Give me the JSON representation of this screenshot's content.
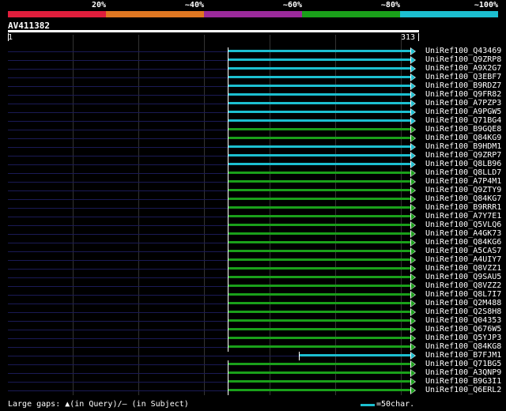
{
  "legend": {
    "colors": [
      "#e01e3c",
      "#e07722",
      "#9b2a9b",
      "#1aa01a",
      "#1cbfd0"
    ],
    "labels": [
      "20%",
      "~40%",
      "~60%",
      "~80%",
      "~100%"
    ]
  },
  "query": {
    "name": "AV411382",
    "start": "1",
    "end": "313"
  },
  "hits": [
    {
      "name": "UniRef100_Q43469",
      "color": "#1cbfd0",
      "start": 288
    },
    {
      "name": "UniRef100_Q9ZRP8",
      "color": "#1cbfd0",
      "start": 288
    },
    {
      "name": "UniRef100_A9X2G7",
      "color": "#1cbfd0",
      "start": 288
    },
    {
      "name": "UniRef100_Q3EBF7",
      "color": "#1cbfd0",
      "start": 288
    },
    {
      "name": "UniRef100_B9RDZ7",
      "color": "#1cbfd0",
      "start": 288
    },
    {
      "name": "UniRef100_Q9FR82",
      "color": "#1cbfd0",
      "start": 288
    },
    {
      "name": "UniRef100_A7PZP3",
      "color": "#1cbfd0",
      "start": 288
    },
    {
      "name": "UniRef100_A9PGW5",
      "color": "#1cbfd0",
      "start": 288
    },
    {
      "name": "UniRef100_Q71BG4",
      "color": "#1cbfd0",
      "start": 288
    },
    {
      "name": "UniRef100_B9GQE8",
      "color": "#1aa01a",
      "start": 288
    },
    {
      "name": "UniRef100_Q84KG9",
      "color": "#1aa01a",
      "start": 288
    },
    {
      "name": "UniRef100_B9HDM1",
      "color": "#1cbfd0",
      "start": 288
    },
    {
      "name": "UniRef100_Q9ZRP7",
      "color": "#1cbfd0",
      "start": 288
    },
    {
      "name": "UniRef100_Q8LB96",
      "color": "#1cbfd0",
      "start": 288
    },
    {
      "name": "UniRef100_Q8LLD7",
      "color": "#1aa01a",
      "start": 288
    },
    {
      "name": "UniRef100_A7P4M1",
      "color": "#1aa01a",
      "start": 288
    },
    {
      "name": "UniRef100_Q9ZTY9",
      "color": "#1aa01a",
      "start": 288
    },
    {
      "name": "UniRef100_Q84KG7",
      "color": "#1aa01a",
      "start": 288
    },
    {
      "name": "UniRef100_B9RRR1",
      "color": "#1aa01a",
      "start": 288
    },
    {
      "name": "UniRef100_A7Y7E1",
      "color": "#1aa01a",
      "start": 288
    },
    {
      "name": "UniRef100_Q5VLQ6",
      "color": "#1aa01a",
      "start": 288
    },
    {
      "name": "UniRef100_A4GK73",
      "color": "#1aa01a",
      "start": 288
    },
    {
      "name": "UniRef100_Q84KG6",
      "color": "#1aa01a",
      "start": 288
    },
    {
      "name": "UniRef100_A5CAS7",
      "color": "#1aa01a",
      "start": 288
    },
    {
      "name": "UniRef100_A4UIY7",
      "color": "#1aa01a",
      "start": 288
    },
    {
      "name": "UniRef100_Q8VZZ1",
      "color": "#1aa01a",
      "start": 288
    },
    {
      "name": "UniRef100_Q9SAU5",
      "color": "#1aa01a",
      "start": 288
    },
    {
      "name": "UniRef100_Q8VZZ2",
      "color": "#1aa01a",
      "start": 288
    },
    {
      "name": "UniRef100_Q8L7I7",
      "color": "#1aa01a",
      "start": 288
    },
    {
      "name": "UniRef100_Q2M488",
      "color": "#1aa01a",
      "start": 288
    },
    {
      "name": "UniRef100_Q2S8H8",
      "color": "#1aa01a",
      "start": 288
    },
    {
      "name": "UniRef100_Q04353",
      "color": "#1aa01a",
      "start": 288
    },
    {
      "name": "UniRef100_Q676W5",
      "color": "#1aa01a",
      "start": 288
    },
    {
      "name": "UniRef100_Q5YJP3",
      "color": "#1aa01a",
      "start": 288
    },
    {
      "name": "UniRef100_Q84KG8",
      "color": "#1aa01a",
      "start": 288
    },
    {
      "name": "UniRef100_B7FJM1",
      "color": "#1cbfd0",
      "start": 378
    },
    {
      "name": "UniRef100_Q71BG5",
      "color": "#1aa01a",
      "start": 288
    },
    {
      "name": "UniRef100_A3QNP9",
      "color": "#1aa01a",
      "start": 288
    },
    {
      "name": "UniRef100_B9G3I1",
      "color": "#1aa01a",
      "start": 288
    },
    {
      "name": "UniRef100_Q6ERL2",
      "color": "#1aa01a",
      "start": 288
    }
  ],
  "footer": {
    "gaps_text": "Large gaps: ▲(in Query)/– (in Subject)",
    "scale_text": "=50char."
  }
}
